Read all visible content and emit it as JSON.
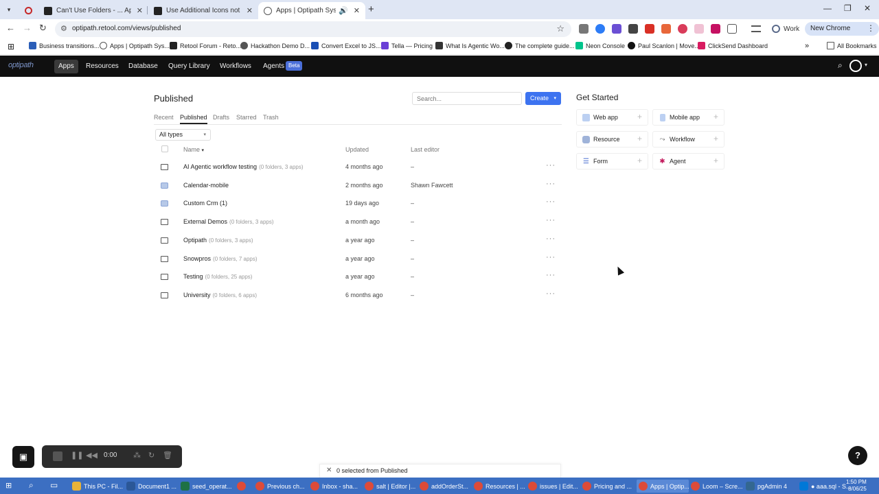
{
  "browser": {
    "tabs": [
      {
        "title": "Can't Use Folders - ... App Bu...",
        "active": false
      },
      {
        "title": "Use Additional Icons not in Ret...",
        "active": false
      },
      {
        "title": "Apps | Optipath Systems",
        "active": true
      }
    ],
    "url": "optipath.retool.com/views/published",
    "profile_label": "Work",
    "update_label": "New Chrome available",
    "bookmarks": [
      "Business transitions...",
      "Apps | Optipath Sys...",
      "Retool Forum - Reto...",
      "Hackathon Demo D...",
      "Convert Excel to JS...",
      "Tella — Pricing",
      "What Is Agentic Wo...",
      "The complete guide...",
      "Neon Console",
      "Paul Scanlon | Move...",
      "ClickSend Dashboard"
    ],
    "all_bookmarks": "All Bookmarks"
  },
  "app": {
    "logo": "optipath",
    "nav": [
      "Apps",
      "Resources",
      "Database",
      "Query Library",
      "Workflows",
      "Agents"
    ],
    "beta": "Beta"
  },
  "main": {
    "title": "Published",
    "search_placeholder": "Search...",
    "create_label": "Create",
    "tabs": [
      "Recent",
      "Published",
      "Drafts",
      "Starred",
      "Trash"
    ],
    "filter": "All types",
    "columns": {
      "name": "Name",
      "updated": "Updated",
      "editor": "Last editor"
    },
    "rows": [
      {
        "name": "AI Agentic workflow testing",
        "meta": "(0 folders, 3 apps)",
        "updated": "4 months ago",
        "editor": "–",
        "type": "folder"
      },
      {
        "name": "Calendar-mobile",
        "meta": "",
        "updated": "2 months ago",
        "editor": "Shawn Fawcett",
        "type": "app"
      },
      {
        "name": "Custom Crm (1)",
        "meta": "",
        "updated": "19 days ago",
        "editor": "–",
        "type": "app"
      },
      {
        "name": "External Demos",
        "meta": "(0 folders, 3 apps)",
        "updated": "a month ago",
        "editor": "–",
        "type": "folder"
      },
      {
        "name": "Optipath",
        "meta": "(0 folders, 3 apps)",
        "updated": "a year ago",
        "editor": "–",
        "type": "folder"
      },
      {
        "name": "Snowpros",
        "meta": "(0 folders, 7 apps)",
        "updated": "a year ago",
        "editor": "–",
        "type": "folder"
      },
      {
        "name": "Testing",
        "meta": "(0 folders, 25 apps)",
        "updated": "a year ago",
        "editor": "–",
        "type": "folder"
      },
      {
        "name": "University",
        "meta": "(0 folders, 6 apps)",
        "updated": "6 months ago",
        "editor": "–",
        "type": "folder"
      }
    ]
  },
  "get_started": {
    "title": "Get Started",
    "cards": [
      "Web app",
      "Mobile app",
      "Resource",
      "Workflow",
      "Form",
      "Agent"
    ]
  },
  "selection": {
    "text": "0 selected from Published"
  },
  "loom": {
    "time": "0:00"
  },
  "taskbar": {
    "apps": [
      "This PC - Fil...",
      "Document1 ...",
      "seed_operat...",
      "Previous ch...",
      "Inbox - sha...",
      "salt | Editor |...",
      "addOrderSt...",
      "Resources | ...",
      "issues | Edit...",
      "Pricing and ...",
      "Apps | Optip...",
      "Loom – Scre...",
      "pgAdmin 4",
      "● aaa.sql - S..."
    ],
    "time": "1:50 PM",
    "date": "8/06/25"
  },
  "colors": {
    "primary": "#3d73f0",
    "header_bg": "#101010",
    "beta": "#4b6fd9",
    "taskbar": "#3c6fc2"
  }
}
